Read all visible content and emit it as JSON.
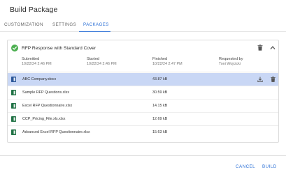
{
  "dialog": {
    "title": "Build Package"
  },
  "tabs": [
    {
      "label": "CUSTOMIZATION"
    },
    {
      "label": "SETTINGS"
    },
    {
      "label": "PACKAGES"
    }
  ],
  "package": {
    "title": "RFP Response with Standard Cover",
    "meta": {
      "submitted_label": "Submitted",
      "submitted_value": "10/22/24 2:46 PM",
      "started_label": "Started",
      "started_value": "10/22/24 2:46 PM",
      "finished_label": "Finished",
      "finished_value": "10/22/24 2:47 PM",
      "requested_label": "Requested by",
      "requested_value": "Toni Wojcicki"
    },
    "files": [
      {
        "name": "ABC Company.docx",
        "size": "43.87 kB",
        "type": "word"
      },
      {
        "name": "Sample RFP Questions.xlsx",
        "size": "30.59 kB",
        "type": "excel"
      },
      {
        "name": "Excel RFP Questionnaire.xlsx",
        "size": "14.15 kB",
        "type": "excel"
      },
      {
        "name": "CCP_Pricing_File.xls.xlsx",
        "size": "12.69 kB",
        "type": "excel"
      },
      {
        "name": "Advanced Excel RFP Questionnaire.xlsx",
        "size": "15.63 kB",
        "type": "excel"
      }
    ]
  },
  "footer": {
    "cancel_label": "CANCEL",
    "build_label": "BUILD"
  },
  "colors": {
    "accent": "#2a6fd6",
    "success": "#4caf50",
    "word": "#2b579a",
    "excel": "#217346",
    "selected_row": "#c9d7f5"
  }
}
